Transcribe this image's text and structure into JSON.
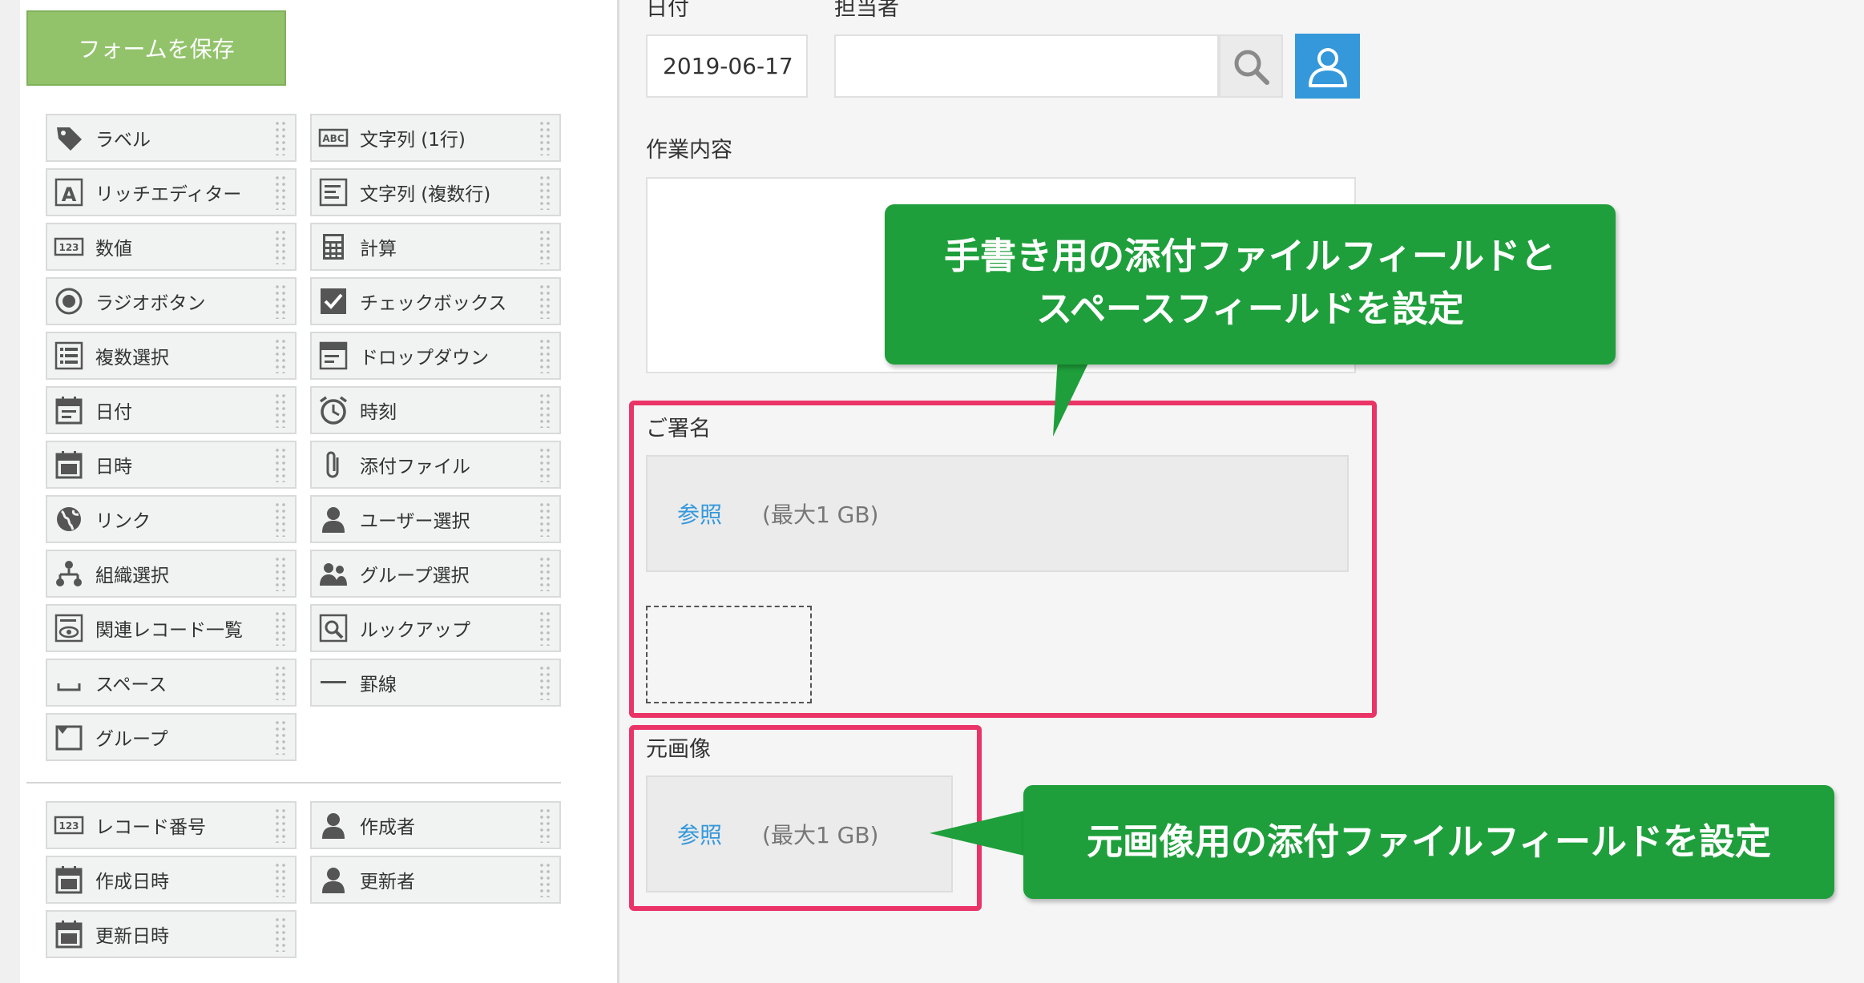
{
  "palette": {
    "save_button": "フォームを保存",
    "items": [
      {
        "label": "ラベル",
        "icon": "tag-icon"
      },
      {
        "label": "文字列 (1行)",
        "icon": "abc-icon"
      },
      {
        "label": "リッチエディター",
        "icon": "rich-editor-icon"
      },
      {
        "label": "文字列 (複数行)",
        "icon": "multiline-text-icon"
      },
      {
        "label": "数値",
        "icon": "number-icon"
      },
      {
        "label": "計算",
        "icon": "calculator-icon"
      },
      {
        "label": "ラジオボタン",
        "icon": "radio-icon"
      },
      {
        "label": "チェックボックス",
        "icon": "checkbox-icon"
      },
      {
        "label": "複数選択",
        "icon": "multi-select-icon"
      },
      {
        "label": "ドロップダウン",
        "icon": "dropdown-icon"
      },
      {
        "label": "日付",
        "icon": "date-icon"
      },
      {
        "label": "時刻",
        "icon": "clock-icon"
      },
      {
        "label": "日時",
        "icon": "datetime-icon"
      },
      {
        "label": "添付ファイル",
        "icon": "paperclip-icon"
      },
      {
        "label": "リンク",
        "icon": "globe-icon"
      },
      {
        "label": "ユーザー選択",
        "icon": "user-icon"
      },
      {
        "label": "組織選択",
        "icon": "org-icon"
      },
      {
        "label": "グループ選択",
        "icon": "group-icon"
      },
      {
        "label": "関連レコード一覧",
        "icon": "related-records-icon"
      },
      {
        "label": "ルックアップ",
        "icon": "lookup-icon"
      },
      {
        "label": "スペース",
        "icon": "space-icon"
      },
      {
        "label": "罫線",
        "icon": "line-icon"
      },
      {
        "label": "グループ",
        "icon": "group-field-icon"
      }
    ],
    "system_items": [
      {
        "label": "レコード番号",
        "icon": "number-icon"
      },
      {
        "label": "作成者",
        "icon": "user-icon"
      },
      {
        "label": "作成日時",
        "icon": "datetime-icon"
      },
      {
        "label": "更新者",
        "icon": "user-icon"
      },
      {
        "label": "更新日時",
        "icon": "datetime-icon"
      }
    ]
  },
  "form": {
    "date_label": "日付",
    "date_value": "2019-06-17",
    "assignee_label": "担当者",
    "work_label": "作業内容",
    "signature_label": "ご署名",
    "signature_browse": "参照",
    "signature_limit": "(最大1 GB)",
    "original_label": "元画像",
    "original_browse": "参照",
    "original_limit": "(最大1 GB)"
  },
  "callouts": {
    "top_line1": "手書き用の添付ファイルフィールドと",
    "top_line2": "スペースフィールドを設定",
    "bottom": "元画像用の添付ファイルフィールドを設定"
  },
  "colors": {
    "save_button": "#92c36b",
    "highlight": "#ea3467",
    "callout": "#1e9f3b",
    "link": "#3498db",
    "user_button": "#3498db"
  }
}
